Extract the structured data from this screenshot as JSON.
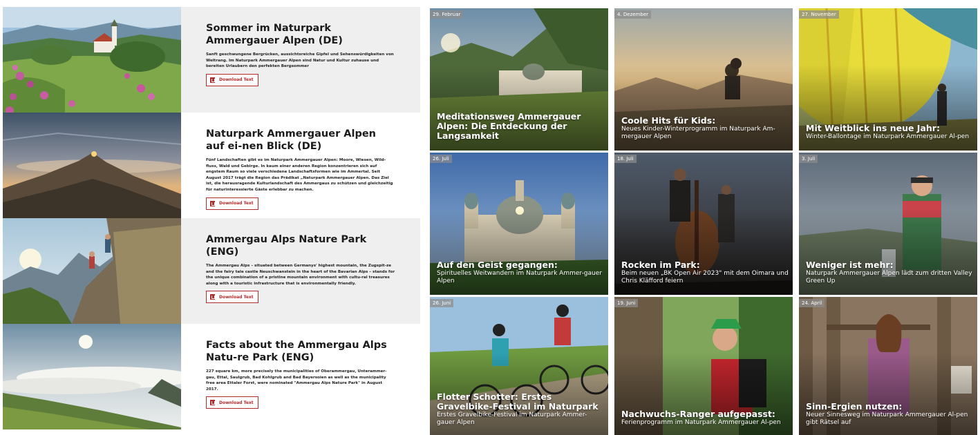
{
  "downloads": [
    {
      "title": "Sommer im Naturpark Ammergauer Alpen (DE)",
      "description": "Sanft geschwungene Bergrücken, aussichtsreiche Gipfel und Sehenswürdigkeiten von Weltrang. Im Naturpark Ammergauer Alpen sind Natur und Kultur zuhause und bereiten Urlaubern den perfekten Bergsommer",
      "button": "Download Text"
    },
    {
      "title": "Naturpark Ammergauer Alpen auf ei-nen Blick (DE)",
      "description": "Fünf Landschaften gibt es im Naturpark Ammergauer Alpen: Moore, Wiesen, Wild-fluss, Wald und Gebirge. In kaum einer anderen Region konzentrieren sich auf engstem Raum so viele verschiedene Landschaftsformen wie im Ammertal. Seit August 2017 trägt die Region das Prädikat „Naturpark Ammergauer Alpen. Das Ziel ist, die herausragende Kulturlandschaft des Ammergaus zu schützen und gleichzeitig für naturinteressierte Gäste erlebbar zu machen.",
      "button": "Download Text"
    },
    {
      "title": "Ammergau Alps Nature Park (ENG)",
      "description": "The Ammergau Alps – situated between Germanys' highest mountain, the Zugspit-ze and the fairy tale castle Neuschwanstein in the heart of the Bavarian Alps – stands for the unique combination of a pristine mountain environment with cultu-ral treasures along with a touristic infrastructure that is environmentally friendly.",
      "button": "Download Text"
    },
    {
      "title": "Facts about the Ammergau Alps Natu-re Park (ENG)",
      "description": "227 square km, more precisely the municipalities of Oberammergau, Unterammer-gau, Ettal, Saulgrub, Bad Kohlgrub and Bad Bayersoien as well as the municipality free area Ettaler Forst, were nominated \"Ammergau Alps Nature Park\" in August 2017.",
      "button": "Download Text"
    }
  ],
  "news": [
    {
      "date": "29. Februar",
      "title": "Meditationsweg Ammergauer Alpen: Die Entdeckung der Langsamkeit",
      "subtitle": ""
    },
    {
      "date": "4. Dezember",
      "title": "Coole Hits für Kids:",
      "subtitle": "Neues Kinder-Winterprogramm im Naturpark Am-mergauer Alpen"
    },
    {
      "date": "27. November",
      "title": "Mit Weitblick ins neue Jahr:",
      "subtitle": "Winter-Ballontage im Naturpark Ammergauer Al-pen"
    },
    {
      "date": "26. Juli",
      "title": "Auf den Geist gegangen:",
      "subtitle": "Spirituelles Weitwandern im Naturpark Ammer-gauer Alpen"
    },
    {
      "date": "18. Juli",
      "title": "Rocken im Park:",
      "subtitle": "Beim neuen „BK Open Air 2023\" mit dem Oimara und Chris Kläfford feiern"
    },
    {
      "date": "3. Juli",
      "title": "Weniger ist mehr:",
      "subtitle": "Naturpark Ammergauer Alpen lädt zum dritten Valley Green Up"
    },
    {
      "date": "26. Juni",
      "title": "Flotter Schotter: Erstes Gravelbike-Festival im Naturpark",
      "subtitle": "Erstes Gravelbike-Festival im Naturpark Ammer-gauer Alpen"
    },
    {
      "date": "19. Juni",
      "title": "Nachwuchs-Ranger aufgepasst:",
      "subtitle": "Ferienprogramm im Naturpark Ammergauer Al-pen"
    },
    {
      "date": "24. April",
      "title": "Sinn-Ergien nutzen:",
      "subtitle": "Neuer Sinnesweg im Naturpark Ammergauer Al-pen gibt Rätsel auf"
    }
  ],
  "icons": {
    "download": "pdf-icon"
  }
}
